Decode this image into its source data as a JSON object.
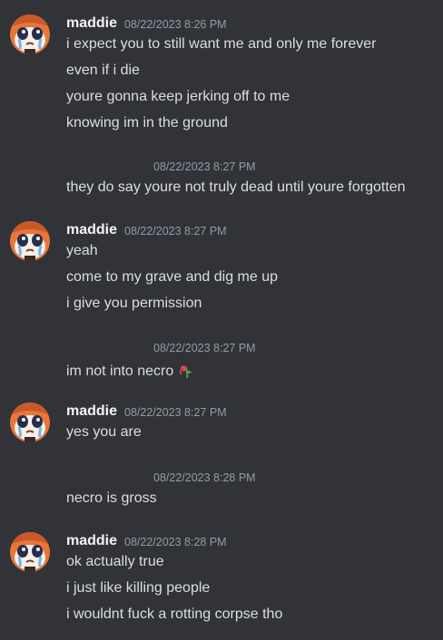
{
  "messages": [
    {
      "type": "group",
      "username": "maddie",
      "timestamp": "08/22/2023 8:26 PM",
      "lines": [
        "i expect you to still want me and only me forever",
        "even if i die",
        "youre gonna keep jerking off to me",
        "knowing im in the ground"
      ]
    },
    {
      "type": "continuation",
      "timestamp": "08/22/2023 8:27 PM",
      "text": "they do say youre not truly dead until youre forgotten"
    },
    {
      "type": "group",
      "username": "maddie",
      "timestamp": "08/22/2023 8:27 PM",
      "lines": [
        "yeah",
        "come to my grave and dig me up",
        "i give you permission"
      ]
    },
    {
      "type": "continuation",
      "timestamp": "08/22/2023 8:27 PM",
      "text": "im not into necro",
      "emoji": "wilted-flower-icon"
    },
    {
      "type": "group",
      "username": "maddie",
      "timestamp": "08/22/2023 8:27 PM",
      "lines": [
        "yes you are"
      ]
    },
    {
      "type": "continuation",
      "timestamp": "08/22/2023 8:28 PM",
      "text": "necro is gross"
    },
    {
      "type": "group",
      "username": "maddie",
      "timestamp": "08/22/2023 8:28 PM",
      "lines": [
        "ok actually true",
        "i just like killing people",
        "i wouldnt fuck a rotting corpse tho"
      ]
    }
  ],
  "colors": {
    "background": "#313338",
    "username": "#f2f3f5",
    "text": "#dbdee1",
    "timestamp": "#949ba4",
    "avatar_orange": "#e8763a"
  }
}
